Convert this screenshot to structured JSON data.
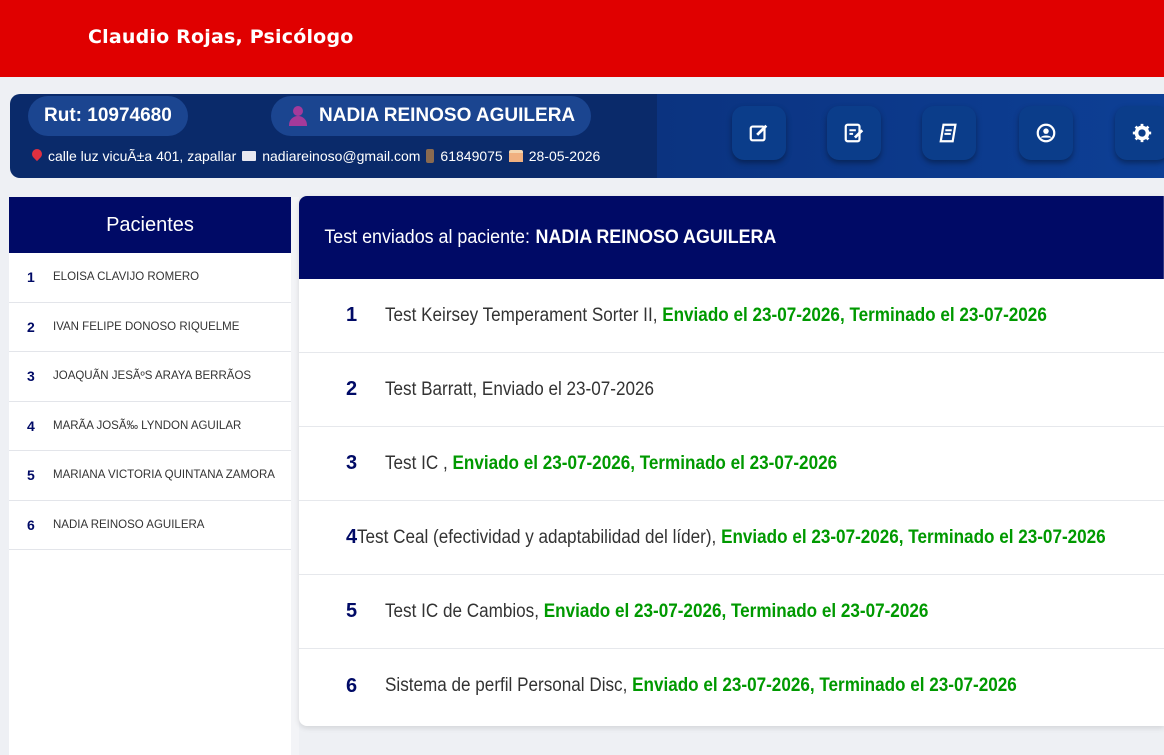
{
  "header": {
    "brand": "Claudio Rojas, Psicólogo",
    "color": "#e00000"
  },
  "patient": {
    "rut": "Rut: 10974680",
    "name": "NADIA REINOSO AGUILERA",
    "address": "calle luz vicuÃ±a 401, zapallar",
    "email": "nadiareinoso@gmail.com",
    "phone": "61849075",
    "birthdate": "28-05-2026"
  },
  "toolbar": {
    "buttons": [
      {
        "icon": "edit-icon"
      },
      {
        "icon": "edit-note-icon"
      },
      {
        "icon": "book-icon"
      },
      {
        "icon": "user-circle-icon"
      },
      {
        "icon": "gear-icon"
      }
    ]
  },
  "sidebar": {
    "title": "Pacientes",
    "items": [
      {
        "num": "1",
        "name": "ELOISA CLAVIJO ROMERO"
      },
      {
        "num": "2",
        "name": "IVAN FELIPE DONOSO RIQUELME"
      },
      {
        "num": "3",
        "name": "JOAQUÃ­N JESÃºS ARAYA BERRÃ­OS"
      },
      {
        "num": "4",
        "name": "MARÃ­A JOSÃ‰ LYNDON AGUILAR"
      },
      {
        "num": "5",
        "name": "MARIANA VICTORIA QUINTANA ZAMORA"
      },
      {
        "num": "6",
        "name": "NADIA REINOSO AGUILERA"
      }
    ]
  },
  "main": {
    "title_prefix": "Test enviados al paciente:",
    "title_name": "NADIA REINOSO AGUILERA",
    "tests": [
      {
        "num": "1",
        "name": "Test Keirsey Temperament Sorter II,",
        "status": "Enviado el 23-07-2026, Terminado el 23-07-2026",
        "completed": true
      },
      {
        "num": "2",
        "name": "Test Barratt, Enviado el 23-07-2026",
        "status": "",
        "completed": false
      },
      {
        "num": "3",
        "name": "Test IC ,",
        "status": "Enviado el 23-07-2026, Terminado el 23-07-2026",
        "completed": true
      },
      {
        "num": "4",
        "name": "Test Ceal (efectividad y adaptabilidad del líder),",
        "status": "Enviado el 23-07-2026, Terminado el 23-07-2026",
        "completed": true
      },
      {
        "num": "5",
        "name": "Test IC de Cambios,",
        "status": "Enviado el 23-07-2026, Terminado el 23-07-2026",
        "completed": true
      },
      {
        "num": "6",
        "name": "Sistema de perfil Personal Disc,",
        "status": "Enviado el 23-07-2026, Terminado el 23-07-2026",
        "completed": true
      }
    ]
  },
  "colors": {
    "navy": "#000a66",
    "green": "#009900",
    "red": "#e00000"
  }
}
